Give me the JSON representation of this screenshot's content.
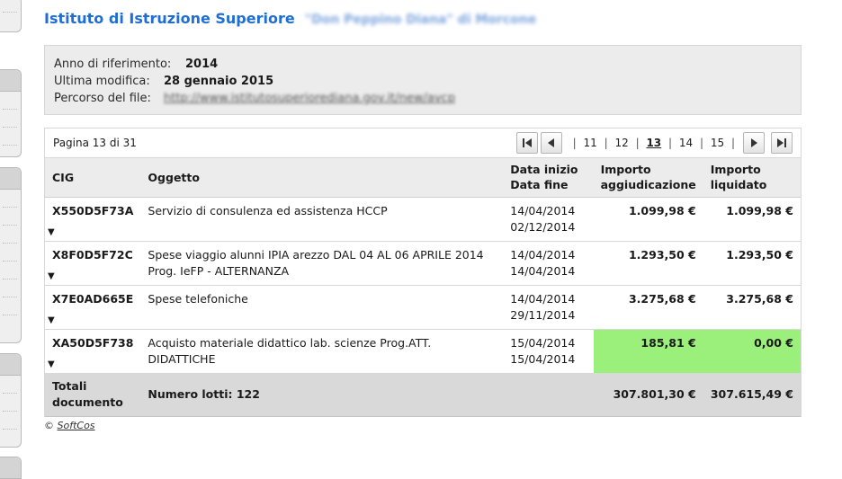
{
  "header": {
    "title": "Istituto di Istruzione Superiore",
    "title_blurred": "\"Don Peppino Diana\" di Morcone"
  },
  "info": {
    "anno_label": "Anno di riferimento:",
    "anno_value": "2014",
    "modifica_label": "Ultima modifica:",
    "modifica_value": "28 gennaio 2015",
    "percorso_label": "Percorso del file:",
    "percorso_value": "http://www.istitutosuperiorediana.gov.it/new/avcp"
  },
  "pager": {
    "status": "Pagina 13 di 31",
    "pages": [
      "11",
      "12",
      "13",
      "14",
      "15"
    ],
    "current": "13"
  },
  "table": {
    "headers": {
      "cig": "CIG",
      "oggetto": "Oggetto",
      "data_inizio": "Data inizio",
      "data_fine": "Data fine",
      "agg_line1": "Importo",
      "agg_line2": "aggiudicazione",
      "liq_line1": "Importo",
      "liq_line2": "liquidato"
    },
    "rows": [
      {
        "cig": "X550D5F73A",
        "oggetto": "Servizio di consulenza ed assistenza HCCP",
        "inizio": "14/04/2014",
        "fine": "02/12/2014",
        "aggiudicazione": "1.099,98 €",
        "liquidato": "1.099,98 €"
      },
      {
        "cig": "X8F0D5F72C",
        "oggetto": "Spese viaggio alunni IPIA arezzo DAL 04 AL 06 APRILE 2014 Prog. IeFP - ALTERNANZA",
        "inizio": "14/04/2014",
        "fine": "14/04/2014",
        "aggiudicazione": "1.293,50 €",
        "liquidato": "1.293,50 €"
      },
      {
        "cig": "X7E0AD665E",
        "oggetto": "Spese telefoniche",
        "inizio": "14/04/2014",
        "fine": "29/11/2014",
        "aggiudicazione": "3.275,68 €",
        "liquidato": "3.275,68 €"
      },
      {
        "cig": "XA50D5F738",
        "oggetto": "Acquisto materiale didattico lab. scienze Prog.ATT. DIDATTICHE",
        "inizio": "15/04/2014",
        "fine": "15/04/2014",
        "aggiudicazione": "185,81 €",
        "liquidato": "0,00 €"
      }
    ],
    "totals": {
      "label_line1": "Totali",
      "label_line2": "documento",
      "lotti": "Numero lotti: 122",
      "aggiudicazione": "307.801,30 €",
      "liquidato": "307.615,49 €"
    }
  },
  "footer": {
    "copyright": "©",
    "link": "SoftCos"
  },
  "colors": {
    "title": "#1f6ed4",
    "highlight": "#9af07a"
  }
}
